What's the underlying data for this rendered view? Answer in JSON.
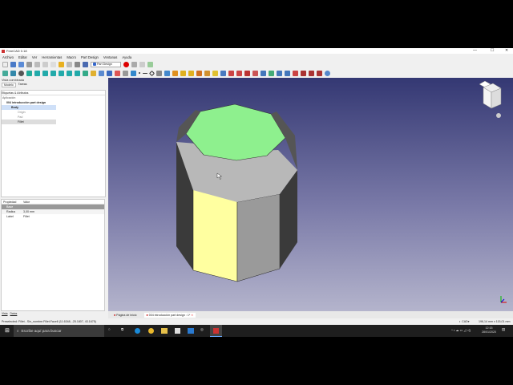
{
  "window": {
    "title": "FreeCAD 0.18",
    "controls": [
      "—",
      "☐",
      "✕"
    ]
  },
  "menu": [
    "Archivo",
    "Editar",
    "Ver",
    "Herramientas",
    "Macro",
    "Part Design",
    "Ventanas",
    "Ayuda"
  ],
  "toolbar": {
    "workbench": "Part Design"
  },
  "combo": {
    "title": "Vista combinada",
    "tabs": [
      "Modelo",
      "Tareas"
    ],
    "section": "Etiquetas & Atributos",
    "app_label": "Aplicación",
    "tree": [
      {
        "label": "004 introducción part design",
        "level": 0
      },
      {
        "label": "Body",
        "level": 1
      },
      {
        "label": "Origin",
        "level": 2
      },
      {
        "label": "Pad",
        "level": 2
      },
      {
        "label": "Fillet",
        "level": 2
      }
    ]
  },
  "props": {
    "headers": [
      "Propiedad",
      "Valor"
    ],
    "group": "Base",
    "rows": [
      {
        "name": "Radius",
        "value": "3,00 mm"
      },
      {
        "name": "Label",
        "value": "Fillet"
      }
    ],
    "bottom_tabs": [
      "Vista",
      "Datos"
    ]
  },
  "doc_tabs": [
    "Página de inicio",
    "004 introducción part design : 1*"
  ],
  "status": {
    "message": "Preselected: Fillet - Sin_nombre.Fillet.Face6 (11.6348, -25.1807, 43.1675)",
    "nav": "CAD",
    "dims": "196,14 mm x 115,01 mm"
  },
  "taskbar": {
    "search_placeholder": "Escribe aquí para buscar",
    "time": "12:15",
    "date": "28/01/2020"
  },
  "colors": {
    "top_face": "#8ef08e",
    "selected_face": "#ffffa0",
    "view_top": "#343873",
    "view_bottom": "#b4b4cc"
  }
}
